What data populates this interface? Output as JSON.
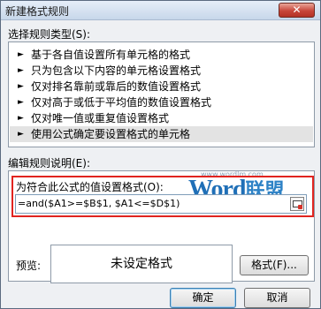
{
  "window": {
    "title": "新建格式规则",
    "close_label": "✕"
  },
  "rule_type": {
    "label": "选择规则类型(S):",
    "items": [
      "基于各自值设置所有单元格的格式",
      "只为包含以下内容的单元格设置格式",
      "仅对排名靠前或靠后的数值设置格式",
      "仅对高于或低于平均值的数值设置格式",
      "仅对唯一值或重复值设置格式",
      "使用公式确定要设置格式的单元格"
    ],
    "selected_index": 5
  },
  "edit_rule": {
    "label": "编辑规则说明(E):",
    "formula_label": "为符合此公式的值设置格式(O):",
    "formula_value": "=and($A1>=$B$1, $A1<=$D$1)"
  },
  "watermark": {
    "url": "www.wordlm.com",
    "logo_main": "Word",
    "logo_cn": "联盟"
  },
  "preview": {
    "label": "预览:",
    "text": "未设定格式",
    "format_button": "格式(F)..."
  },
  "footer": {
    "ok": "确定",
    "cancel": "取消"
  }
}
